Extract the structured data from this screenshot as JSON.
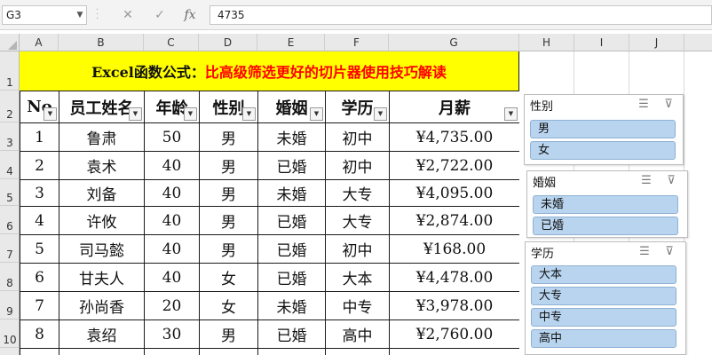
{
  "formula_bar": {
    "name_box": "G3",
    "cancel_icon": "✕",
    "enter_icon": "✓",
    "fx_label": "fx",
    "formula": "4735"
  },
  "columns": [
    "A",
    "B",
    "C",
    "D",
    "E",
    "F",
    "G",
    "H",
    "I",
    "J"
  ],
  "rows": [
    "1",
    "2",
    "3",
    "4",
    "5",
    "6",
    "7",
    "8",
    "9",
    "10"
  ],
  "sheet": {
    "title_black": "Excel函数公式：",
    "title_red": "比高级筛选更好的切片器使用技巧解读",
    "headers": [
      "No",
      "员工姓名",
      "年龄",
      "性别",
      "婚姻",
      "学历",
      "月薪"
    ],
    "data": [
      [
        "1",
        "鲁肃",
        "50",
        "男",
        "未婚",
        "初中",
        "¥4,735.00"
      ],
      [
        "2",
        "袁术",
        "40",
        "男",
        "已婚",
        "初中",
        "¥2,722.00"
      ],
      [
        "3",
        "刘备",
        "40",
        "男",
        "未婚",
        "大专",
        "¥4,095.00"
      ],
      [
        "4",
        "许攸",
        "40",
        "男",
        "已婚",
        "大专",
        "¥2,874.00"
      ],
      [
        "5",
        "司马懿",
        "40",
        "男",
        "已婚",
        "初中",
        "¥168.00"
      ],
      [
        "6",
        "甘夫人",
        "40",
        "女",
        "已婚",
        "大本",
        "¥4,478.00"
      ],
      [
        "7",
        "孙尚香",
        "20",
        "女",
        "未婚",
        "中专",
        "¥3,978.00"
      ],
      [
        "8",
        "袁绍",
        "30",
        "男",
        "已婚",
        "高中",
        "¥2,760.00"
      ]
    ]
  },
  "slicers": {
    "gender": {
      "title": "性别",
      "items": [
        "男",
        "女"
      ]
    },
    "marriage": {
      "title": "婚姻",
      "items": [
        "未婚",
        "已婚"
      ]
    },
    "education": {
      "title": "学历",
      "items": [
        "大本",
        "大专",
        "中专",
        "高中"
      ]
    }
  },
  "colors": {
    "title_fill": "#ffff00",
    "title_red": "#ff0000",
    "slicer_item": "#b8d4ee"
  },
  "icons": {
    "multi_select": "multi-select-icon",
    "clear_filter": "clear-filter-icon",
    "filter_dropdown": "filter-dropdown-icon"
  }
}
